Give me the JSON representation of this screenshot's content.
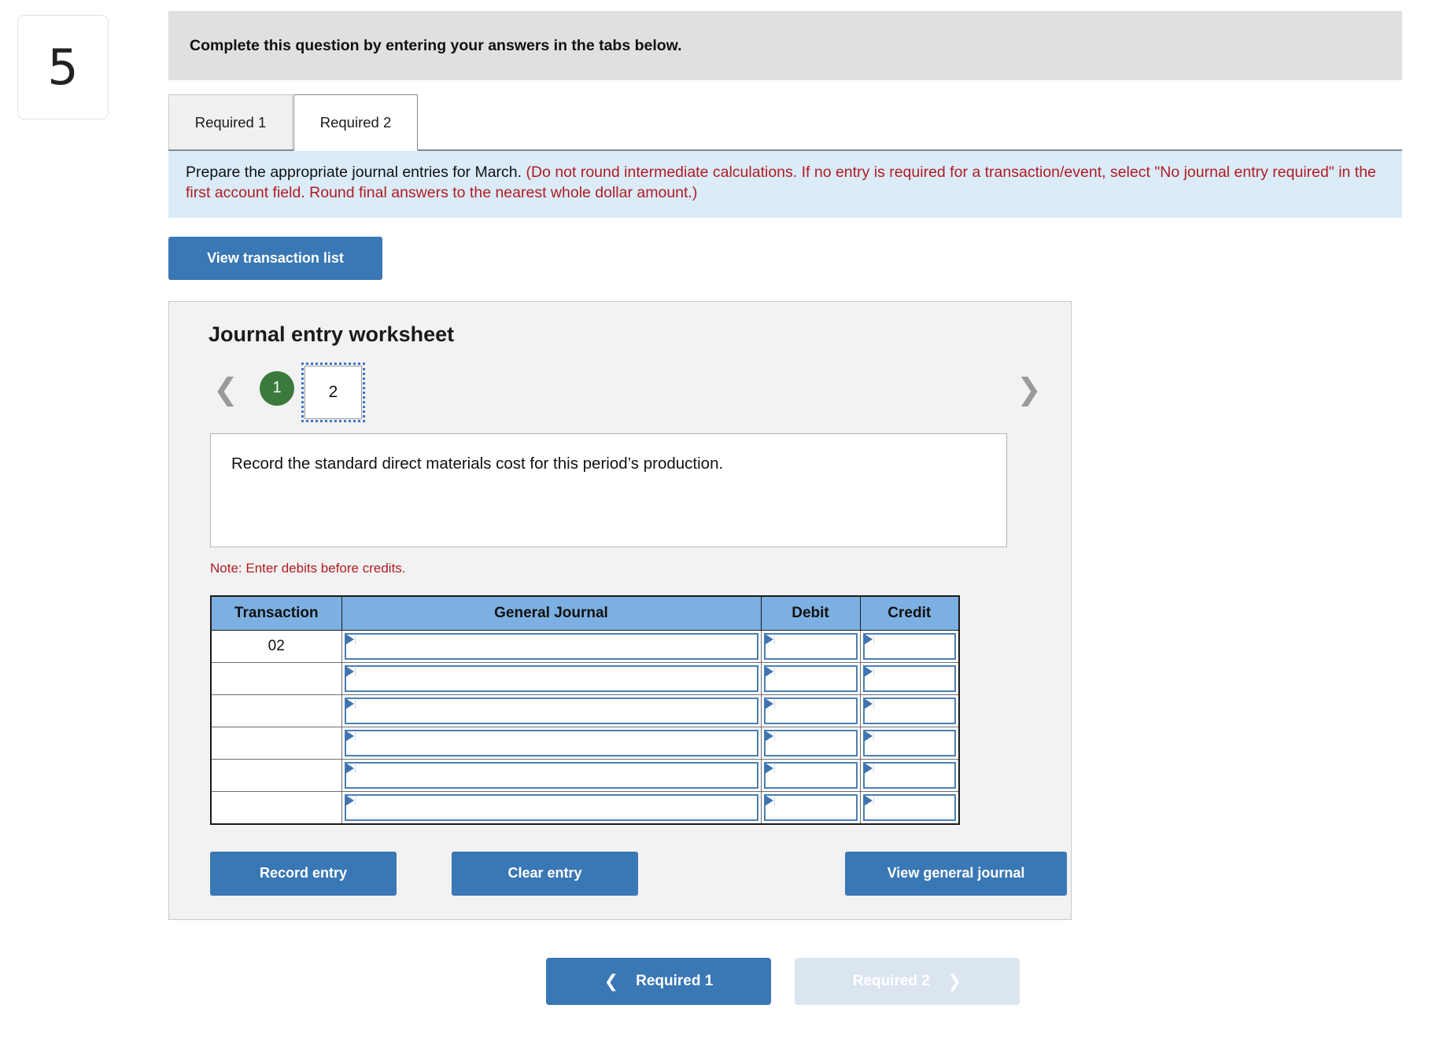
{
  "question_number": "5",
  "prompt_bar": {
    "text": "Complete this question by entering your answers in the tabs below."
  },
  "tabs": [
    {
      "label": "Required 1",
      "active": false
    },
    {
      "label": "Required 2",
      "active": true
    }
  ],
  "instruction": {
    "black_text": "Prepare the appropriate journal entries for March. ",
    "red_text": "(Do not round intermediate calculations. If no entry is required for a transaction/event, select \"No journal entry required\" in the first account field. Round final answers to the nearest whole dollar amount.)",
    "background_color": "#dbebf8",
    "red_color": "#b01c22"
  },
  "view_transaction_list_button": "View transaction list",
  "worksheet": {
    "title": "Journal entry worksheet",
    "pager": {
      "prev_icon": "chevron-left-icon",
      "next_icon": "chevron-right-icon",
      "completed_page": "1",
      "current_page": "2",
      "completed_color": "#3b7a3b",
      "focus_outline_color": "#3f74c6"
    },
    "description": "Record the standard direct materials cost for this period’s production.",
    "note": "Note: Enter debits before credits.",
    "table": {
      "headers": [
        "Transaction",
        "General Journal",
        "Debit",
        "Credit"
      ],
      "header_color": "#7db0e2",
      "rows": [
        {
          "transaction": "02",
          "general_journal": "",
          "debit": "",
          "credit": ""
        },
        {
          "transaction": "",
          "general_journal": "",
          "debit": "",
          "credit": ""
        },
        {
          "transaction": "",
          "general_journal": "",
          "debit": "",
          "credit": ""
        },
        {
          "transaction": "",
          "general_journal": "",
          "debit": "",
          "credit": ""
        },
        {
          "transaction": "",
          "general_journal": "",
          "debit": "",
          "credit": ""
        },
        {
          "transaction": "",
          "general_journal": "",
          "debit": "",
          "credit": ""
        }
      ]
    },
    "actions": {
      "record_entry": "Record entry",
      "clear_entry": "Clear entry",
      "view_general_journal": "View general journal"
    }
  },
  "footer_nav": {
    "prev": {
      "label": "Required 1",
      "icon": "chevron-left-icon"
    },
    "next": {
      "label": "Required 2",
      "icon": "chevron-right-icon",
      "disabled": true
    }
  },
  "colors": {
    "primary_blue": "#3a77b5",
    "disabled_blue": "#dbe5f0",
    "panel_gray": "#f2f2f2",
    "prompt_gray": "#e0e0e0"
  }
}
